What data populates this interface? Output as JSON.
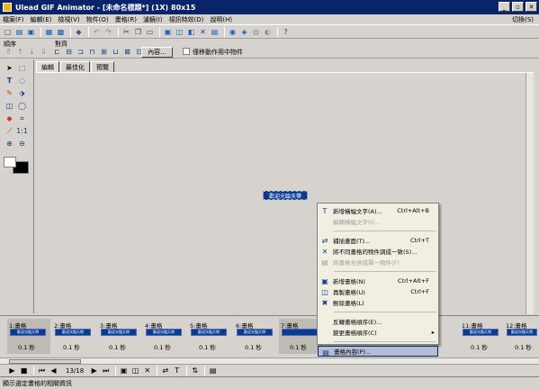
{
  "window": {
    "title": "Ulead GIF Animator - [未命名標題*] (1X) 80x15"
  },
  "menubar": {
    "items": [
      "檔案(F)",
      "編輯(E)",
      "檢視(V)",
      "物件(O)",
      "畫格(R)",
      "濾鏡(I)",
      "視訊特效(D)",
      "說明(H)"
    ],
    "switch": "切換(S)"
  },
  "order_bar": {
    "order_label": "順序",
    "align_label": "對齊",
    "properties_button": "內容...",
    "checkbox_label": "僅移動作用中物件"
  },
  "editor": {
    "tabs": [
      "編輯",
      "最佳化",
      "預覽"
    ]
  },
  "canvas": {
    "banner_text": "歡迎光臨天帶"
  },
  "frames": [
    {
      "label": "1:畫格",
      "thumb": "歡迎光臨天帶",
      "delay": "0.1 秒"
    },
    {
      "label": "2:畫格",
      "thumb": "歡迎光臨天帶",
      "delay": "0.1 秒"
    },
    {
      "label": "3:畫格",
      "thumb": "歡迎光臨天帶",
      "delay": "0.1 秒"
    },
    {
      "label": "4:畫格",
      "thumb": "歡迎光臨天帶",
      "delay": "0.1 秒"
    },
    {
      "label": "5:畫格",
      "thumb": "歡迎光臨天帶",
      "delay": "0.1 秒"
    },
    {
      "label": "6:畫格",
      "thumb": "歡迎光臨天帶",
      "delay": "0.1 秒"
    },
    {
      "label": "7:畫格",
      "thumb": "",
      "delay": "0.1 秒"
    },
    {
      "label": "11:畫格",
      "thumb": "歡迎光臨天帶",
      "delay": "0.1 秒"
    },
    {
      "label": "12:畫格",
      "thumb": "歡迎光臨天帶",
      "delay": "0.1 秒"
    }
  ],
  "playback": {
    "counter": "13/18"
  },
  "status": {
    "text": "顯示選定畫格的相關資訊"
  },
  "context_menu": {
    "add_banner": {
      "label": "新增橫幅文字(A)...",
      "shortcut": "Ctrl+Alt+B"
    },
    "edit_banner": {
      "label": "編輯橫幅文字(I)..."
    },
    "tween": {
      "label": "補插畫面(T)...",
      "shortcut": "Ctrl+T"
    },
    "unify": {
      "label": "將不同畫格的物件調成一致(S)..."
    },
    "merge": {
      "label": "將畫格合併成單一物件(F)"
    },
    "add_frame": {
      "label": "新增畫格(N)",
      "shortcut": "Ctrl+Alt+F"
    },
    "dup_frame": {
      "label": "再製畫格(U)",
      "shortcut": "Ctrl+F"
    },
    "del_frame": {
      "label": "刪除畫格(L)"
    },
    "reverse": {
      "label": "反轉畫格順序(E)..."
    },
    "change_order": {
      "label": "變更畫格順序(C)"
    },
    "frame_props": {
      "label": "畫格內容(P)..."
    }
  }
}
